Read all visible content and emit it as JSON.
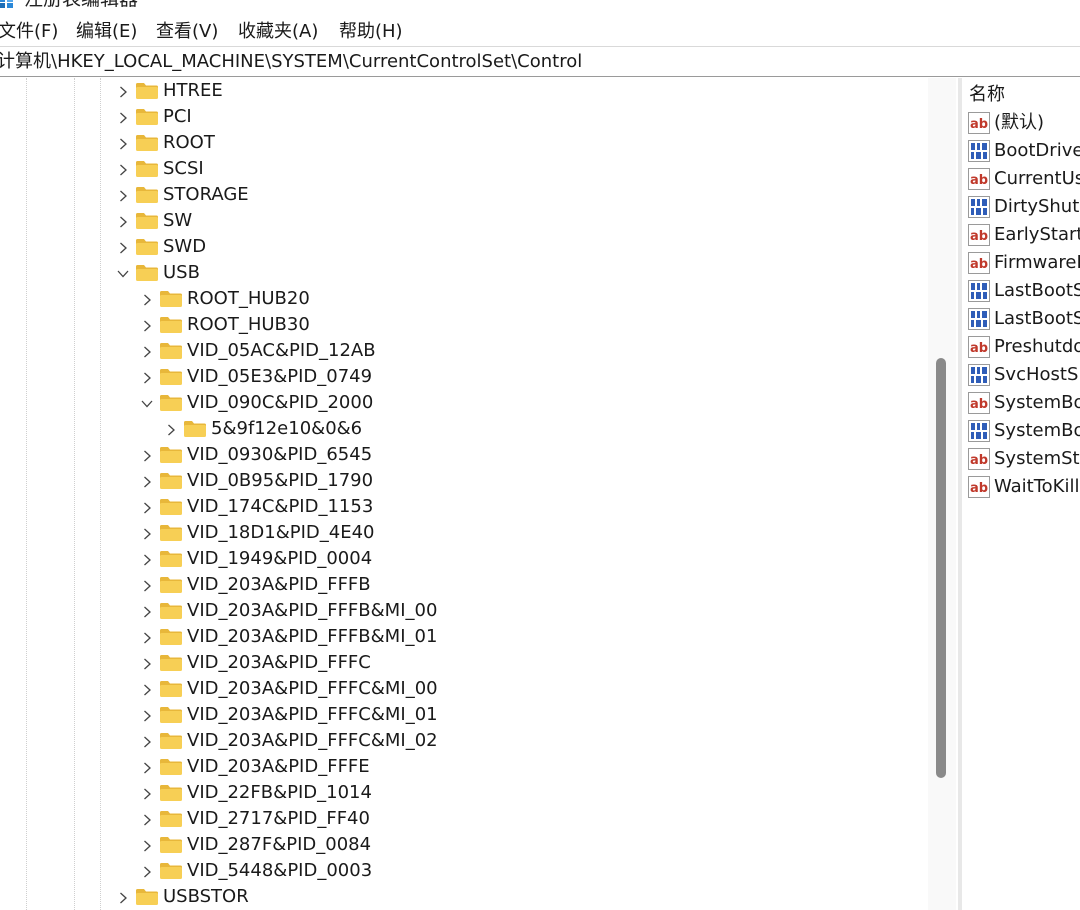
{
  "window": {
    "title": "注册表编辑器"
  },
  "menu": [
    "文件(F)",
    "编辑(E)",
    "查看(V)",
    "收藏夹(A)",
    "帮助(H)"
  ],
  "address": {
    "path": "计算机\\HKEY_LOCAL_MACHINE\\SYSTEM\\CurrentControlSet\\Control"
  },
  "tree": [
    {
      "label": "HTREE",
      "level": 0,
      "expanded": false
    },
    {
      "label": "PCI",
      "level": 0,
      "expanded": false
    },
    {
      "label": "ROOT",
      "level": 0,
      "expanded": false
    },
    {
      "label": "SCSI",
      "level": 0,
      "expanded": false
    },
    {
      "label": "STORAGE",
      "level": 0,
      "expanded": false
    },
    {
      "label": "SW",
      "level": 0,
      "expanded": false
    },
    {
      "label": "SWD",
      "level": 0,
      "expanded": false
    },
    {
      "label": "USB",
      "level": 0,
      "expanded": true
    },
    {
      "label": "ROOT_HUB20",
      "level": 1,
      "expanded": false
    },
    {
      "label": "ROOT_HUB30",
      "level": 1,
      "expanded": false
    },
    {
      "label": "VID_05AC&PID_12AB",
      "level": 1,
      "expanded": false
    },
    {
      "label": "VID_05E3&PID_0749",
      "level": 1,
      "expanded": false
    },
    {
      "label": "VID_090C&PID_2000",
      "level": 1,
      "expanded": true
    },
    {
      "label": "5&9f12e10&0&6",
      "level": 2,
      "expanded": false
    },
    {
      "label": "VID_0930&PID_6545",
      "level": 1,
      "expanded": false
    },
    {
      "label": "VID_0B95&PID_1790",
      "level": 1,
      "expanded": false
    },
    {
      "label": "VID_174C&PID_1153",
      "level": 1,
      "expanded": false
    },
    {
      "label": "VID_18D1&PID_4E40",
      "level": 1,
      "expanded": false
    },
    {
      "label": "VID_1949&PID_0004",
      "level": 1,
      "expanded": false
    },
    {
      "label": "VID_203A&PID_FFFB",
      "level": 1,
      "expanded": false
    },
    {
      "label": "VID_203A&PID_FFFB&MI_00",
      "level": 1,
      "expanded": false
    },
    {
      "label": "VID_203A&PID_FFFB&MI_01",
      "level": 1,
      "expanded": false
    },
    {
      "label": "VID_203A&PID_FFFC",
      "level": 1,
      "expanded": false
    },
    {
      "label": "VID_203A&PID_FFFC&MI_00",
      "level": 1,
      "expanded": false
    },
    {
      "label": "VID_203A&PID_FFFC&MI_01",
      "level": 1,
      "expanded": false
    },
    {
      "label": "VID_203A&PID_FFFC&MI_02",
      "level": 1,
      "expanded": false
    },
    {
      "label": "VID_203A&PID_FFFE",
      "level": 1,
      "expanded": false
    },
    {
      "label": "VID_22FB&PID_1014",
      "level": 1,
      "expanded": false
    },
    {
      "label": "VID_2717&PID_FF40",
      "level": 1,
      "expanded": false
    },
    {
      "label": "VID_287F&PID_0084",
      "level": 1,
      "expanded": false
    },
    {
      "label": "VID_5448&PID_0003",
      "level": 1,
      "expanded": false
    },
    {
      "label": "USBSTOR",
      "level": 0,
      "expanded": false
    }
  ],
  "values_pane": {
    "header": "名称",
    "rows": [
      {
        "name": "(默认)",
        "type": "string"
      },
      {
        "name": "BootDrive",
        "type": "binary"
      },
      {
        "name": "CurrentUs",
        "type": "string"
      },
      {
        "name": "DirtyShutd",
        "type": "binary"
      },
      {
        "name": "EarlyStartS",
        "type": "string"
      },
      {
        "name": "FirmwareB",
        "type": "string"
      },
      {
        "name": "LastBootSh",
        "type": "binary"
      },
      {
        "name": "LastBootSu",
        "type": "binary"
      },
      {
        "name": "Preshutdo",
        "type": "string"
      },
      {
        "name": "SvcHostSp",
        "type": "binary"
      },
      {
        "name": "SystemBoo",
        "type": "string"
      },
      {
        "name": "SystemBoo",
        "type": "binary"
      },
      {
        "name": "SystemSta",
        "type": "string"
      },
      {
        "name": "WaitToKill",
        "type": "string"
      }
    ]
  },
  "icons": {
    "app": "registry-editor-icon",
    "folder": "folder-icon",
    "string_value": "string-value-icon",
    "binary_value": "binary-value-icon"
  },
  "colors": {
    "folder_body": "#f7cf55",
    "folder_tab": "#e8b73a",
    "string_icon_red": "#c0392b",
    "binary_icon_blue": "#2f5db8",
    "scrollbar_thumb": "#8a8a8a"
  }
}
